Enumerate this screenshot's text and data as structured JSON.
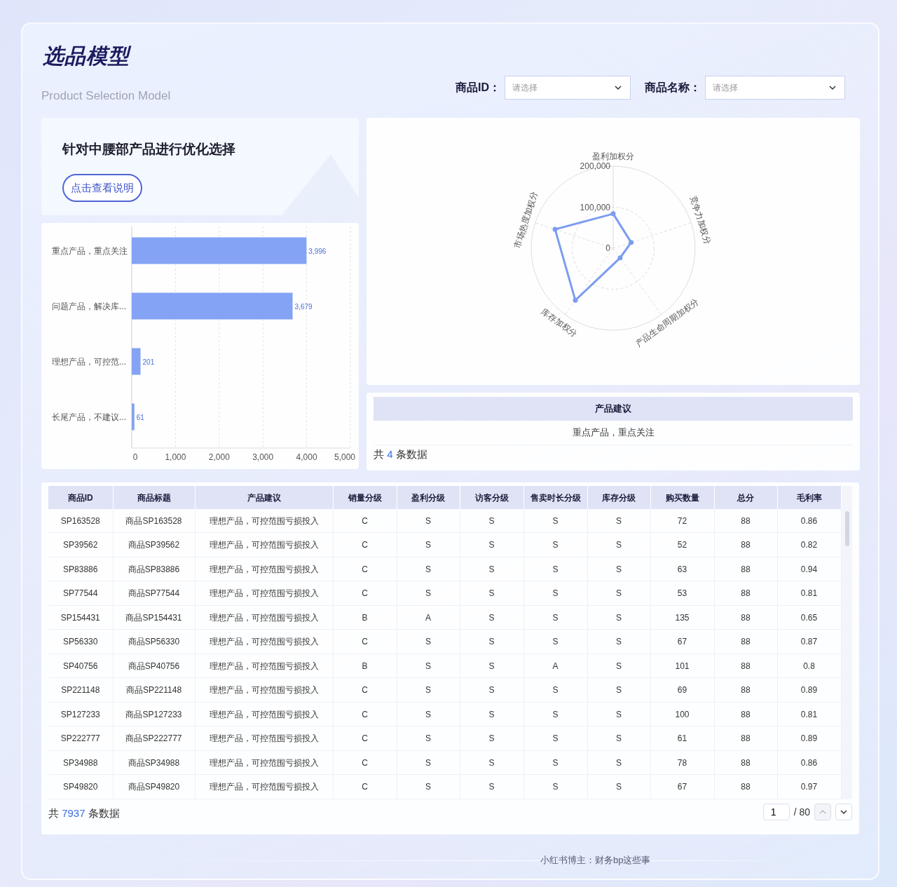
{
  "header": {
    "title": "选品模型",
    "subtitle": "Product Selection Model"
  },
  "filters": [
    {
      "label": "商品ID：",
      "placeholder": "请选择"
    },
    {
      "label": "商品名称：",
      "placeholder": "请选择"
    }
  ],
  "intro_card": {
    "heading": "针对中腰部产品进行优化选择",
    "button": "点击查看说明"
  },
  "bar_chart": {
    "chart_data": {
      "type": "bar",
      "orientation": "horizontal",
      "categories": [
        "重点产品，重点关注",
        "问题产品，解决库...",
        "理想产品，可控范...",
        "长尾产品，不建议..."
      ],
      "values": [
        3996,
        3679,
        201,
        61
      ],
      "value_labels": [
        "3,996",
        "3,679",
        "201",
        "61"
      ],
      "xlim": [
        0,
        5000
      ],
      "xticks": [
        {
          "value": 0,
          "label": "0"
        },
        {
          "value": 1000,
          "label": "1,000"
        },
        {
          "value": 2000,
          "label": "2,000"
        },
        {
          "value": 3000,
          "label": "3,000"
        },
        {
          "value": 4000,
          "label": "4,000"
        },
        {
          "value": 5000,
          "label": "5,000"
        }
      ],
      "grid": true
    }
  },
  "radar_chart": {
    "chart_data": {
      "type": "radar",
      "categories": [
        "盈利加权分",
        "竞争力加权分",
        "产品生命周期加权分",
        "库存加权分",
        "市场热度加权分"
      ],
      "ylim": [
        0,
        200000
      ],
      "yticks": [
        {
          "value": 0,
          "label": "0"
        },
        {
          "value": 100000,
          "label": "100,000"
        },
        {
          "value": 200000,
          "label": "200,000"
        }
      ],
      "values": [
        84000,
        46000,
        29000,
        157000,
        149000
      ]
    }
  },
  "suggestion_table": {
    "column": "产品建议",
    "rows": [
      "重点产品，重点关注"
    ],
    "total": {
      "prefix": "共",
      "count": "4",
      "suffix": "条数据"
    }
  },
  "product_table": {
    "columns": [
      "商品ID",
      "商品标题",
      "产品建议",
      "销量分级",
      "盈利分级",
      "访客分级",
      "售卖时长分级",
      "库存分级",
      "购买数量",
      "总分",
      "毛利率"
    ],
    "rows": [
      [
        "SP163528",
        "商品SP163528",
        "理想产品，可控范围亏损投入",
        "C",
        "S",
        "S",
        "S",
        "S",
        "72",
        "88",
        "0.86"
      ],
      [
        "SP39562",
        "商品SP39562",
        "理想产品，可控范围亏损投入",
        "C",
        "S",
        "S",
        "S",
        "S",
        "52",
        "88",
        "0.82"
      ],
      [
        "SP83886",
        "商品SP83886",
        "理想产品，可控范围亏损投入",
        "C",
        "S",
        "S",
        "S",
        "S",
        "63",
        "88",
        "0.94"
      ],
      [
        "SP77544",
        "商品SP77544",
        "理想产品，可控范围亏损投入",
        "C",
        "S",
        "S",
        "S",
        "S",
        "53",
        "88",
        "0.81"
      ],
      [
        "SP154431",
        "商品SP154431",
        "理想产品，可控范围亏损投入",
        "B",
        "A",
        "S",
        "S",
        "S",
        "135",
        "88",
        "0.65"
      ],
      [
        "SP56330",
        "商品SP56330",
        "理想产品，可控范围亏损投入",
        "C",
        "S",
        "S",
        "S",
        "S",
        "67",
        "88",
        "0.87"
      ],
      [
        "SP40756",
        "商品SP40756",
        "理想产品，可控范围亏损投入",
        "B",
        "S",
        "S",
        "A",
        "S",
        "101",
        "88",
        "0.8"
      ],
      [
        "SP221148",
        "商品SP221148",
        "理想产品，可控范围亏损投入",
        "C",
        "S",
        "S",
        "S",
        "S",
        "69",
        "88",
        "0.89"
      ],
      [
        "SP127233",
        "商品SP127233",
        "理想产品，可控范围亏损投入",
        "C",
        "S",
        "S",
        "S",
        "S",
        "100",
        "88",
        "0.81"
      ],
      [
        "SP222777",
        "商品SP222777",
        "理想产品，可控范围亏损投入",
        "C",
        "S",
        "S",
        "S",
        "S",
        "61",
        "88",
        "0.89"
      ],
      [
        "SP34988",
        "商品SP34988",
        "理想产品，可控范围亏损投入",
        "C",
        "S",
        "S",
        "S",
        "S",
        "78",
        "88",
        "0.86"
      ],
      [
        "SP49820",
        "商品SP49820",
        "理想产品，可控范围亏损投入",
        "C",
        "S",
        "S",
        "S",
        "S",
        "67",
        "88",
        "0.97"
      ]
    ],
    "total": {
      "prefix": "共",
      "count": "7937",
      "suffix": "条数据"
    },
    "pagination": {
      "page": "1",
      "of": "/ 80",
      "prev_disabled": true,
      "next_disabled": false
    }
  },
  "footer": {
    "credit": "小红书博主：财务bp这些事"
  }
}
